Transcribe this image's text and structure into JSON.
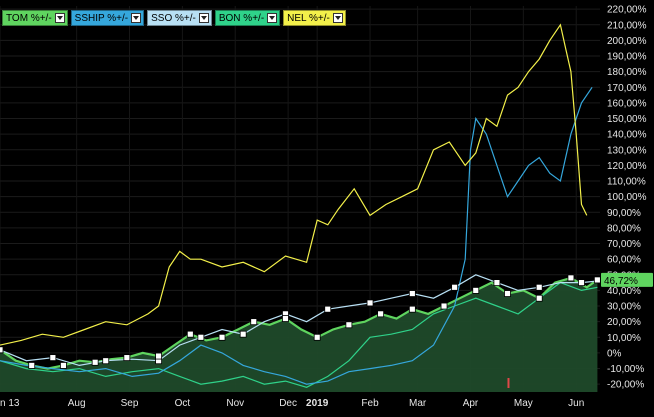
{
  "legend": [
    {
      "label": "TOM %+/-",
      "color": "#5fd45f"
    },
    {
      "label": "SSHIP %+/-",
      "color": "#35a7dc"
    },
    {
      "label": "SSO %+/-",
      "color": "#b8e0f4"
    },
    {
      "label": "BON %+/-",
      "color": "#2fd28a"
    },
    {
      "label": "NEL %+/-",
      "color": "#f3f04a"
    }
  ],
  "last_value_label": "46,72%",
  "chart_data": {
    "type": "line",
    "ylim": [
      -25,
      222
    ],
    "y_ticks": [
      "220,00%",
      "210,00%",
      "200,00%",
      "190,00%",
      "180,00%",
      "170,00%",
      "160,00%",
      "150,00%",
      "140,00%",
      "130,00%",
      "120,00%",
      "110,00%",
      "100,00%",
      "90,00%",
      "80,00%",
      "70,00%",
      "60,00%",
      "50,00%",
      "40,00%",
      "30,00%",
      "20,00%",
      "10,00%",
      "0%",
      "-10,00%",
      "-20,00%"
    ],
    "y_tick_values": [
      220,
      210,
      200,
      190,
      180,
      170,
      160,
      150,
      140,
      130,
      120,
      110,
      100,
      90,
      80,
      70,
      60,
      50,
      40,
      30,
      20,
      10,
      0,
      -10,
      -20
    ],
    "x_tick_labels": [
      "n 13",
      "Aug",
      "Sep",
      "Oct",
      "Nov",
      "Dec",
      "2019",
      "Feb",
      "Mar",
      "Apr",
      "May",
      "Jun"
    ],
    "x_tick_pos": [
      0,
      1.45,
      2.45,
      3.45,
      4.45,
      5.45,
      6.0,
      7.0,
      7.9,
      8.9,
      9.9,
      10.9
    ],
    "x_range": [
      0,
      11.35
    ],
    "series": [
      {
        "name": "NEL %+/-",
        "color": "#f3f04a",
        "x": [
          0,
          0.4,
          0.8,
          1.2,
          1.6,
          2.0,
          2.4,
          2.8,
          3.0,
          3.2,
          3.4,
          3.6,
          3.8,
          4.2,
          4.6,
          5.0,
          5.4,
          5.8,
          6.0,
          6.2,
          6.4,
          6.7,
          7.0,
          7.3,
          7.6,
          7.9,
          8.2,
          8.5,
          8.8,
          9.0,
          9.2,
          9.4,
          9.6,
          9.8,
          10.0,
          10.2,
          10.4,
          10.6,
          10.7,
          10.8,
          10.9,
          11.0,
          11.1
        ],
        "values": [
          5,
          8,
          12,
          10,
          15,
          20,
          18,
          25,
          30,
          55,
          65,
          60,
          60,
          55,
          58,
          52,
          62,
          58,
          85,
          82,
          92,
          105,
          88,
          95,
          100,
          105,
          130,
          135,
          120,
          128,
          150,
          145,
          165,
          170,
          180,
          188,
          200,
          210,
          195,
          180,
          140,
          95,
          88
        ]
      },
      {
        "name": "SSHIP %+/-",
        "color": "#35a7dc",
        "x": [
          0,
          0.5,
          1.0,
          1.5,
          2.0,
          2.5,
          3.0,
          3.4,
          3.8,
          4.2,
          4.6,
          5.0,
          5.4,
          5.8,
          6.2,
          6.6,
          7.0,
          7.4,
          7.8,
          8.2,
          8.6,
          8.8,
          8.9,
          9.0,
          9.2,
          9.4,
          9.6,
          9.8,
          10.0,
          10.2,
          10.4,
          10.6,
          10.8,
          11.0,
          11.2
        ],
        "values": [
          -5,
          -8,
          -10,
          -12,
          -10,
          -15,
          -13,
          -5,
          5,
          0,
          -8,
          -12,
          -15,
          -20,
          -18,
          -12,
          -10,
          -8,
          -5,
          5,
          30,
          60,
          130,
          150,
          140,
          120,
          100,
          110,
          120,
          125,
          115,
          110,
          140,
          160,
          170
        ]
      },
      {
        "name": "SSO %+/-",
        "color": "#b8e0f4",
        "x": [
          0,
          0.5,
          1.0,
          1.5,
          2.0,
          2.5,
          3.0,
          3.4,
          3.8,
          4.2,
          4.6,
          5.0,
          5.4,
          5.8,
          6.2,
          6.6,
          7.0,
          7.4,
          7.8,
          8.2,
          8.6,
          9.0,
          9.4,
          9.8,
          10.2,
          10.6,
          11.0,
          11.3
        ],
        "values": [
          2,
          -5,
          -3,
          -8,
          -5,
          -4,
          -5,
          5,
          10,
          15,
          12,
          20,
          25,
          20,
          28,
          30,
          32,
          35,
          38,
          35,
          42,
          50,
          45,
          40,
          42,
          45,
          45,
          46
        ]
      },
      {
        "name": "BON %+/-",
        "color": "#2fd28a",
        "x": [
          0,
          0.5,
          1.0,
          1.5,
          2.0,
          2.5,
          3.0,
          3.4,
          3.8,
          4.2,
          4.6,
          5.0,
          5.4,
          5.8,
          6.2,
          6.6,
          7.0,
          7.4,
          7.8,
          8.2,
          8.6,
          9.0,
          9.4,
          9.8,
          10.2,
          10.6,
          11.0,
          11.3
        ],
        "values": [
          -5,
          -10,
          -12,
          -10,
          -15,
          -12,
          -10,
          -15,
          -20,
          -18,
          -15,
          -20,
          -18,
          -22,
          -15,
          -5,
          10,
          12,
          15,
          25,
          30,
          35,
          30,
          25,
          35,
          45,
          40,
          42
        ]
      },
      {
        "name": "TOM %+/-",
        "color": "#5fd45f",
        "fill": "#1f4a2a",
        "x": [
          0,
          0.3,
          0.6,
          0.9,
          1.2,
          1.5,
          1.8,
          2.1,
          2.4,
          2.7,
          3.0,
          3.3,
          3.6,
          3.9,
          4.2,
          4.5,
          4.8,
          5.1,
          5.4,
          5.7,
          6.0,
          6.3,
          6.6,
          6.9,
          7.2,
          7.5,
          7.8,
          8.1,
          8.4,
          8.7,
          9.0,
          9.3,
          9.6,
          9.9,
          10.2,
          10.5,
          10.8,
          11.1,
          11.3
        ],
        "values": [
          2,
          -5,
          -8,
          -10,
          -8,
          -5,
          -6,
          -4,
          -3,
          0,
          -2,
          5,
          12,
          8,
          10,
          15,
          20,
          18,
          22,
          15,
          10,
          15,
          18,
          20,
          25,
          22,
          28,
          25,
          30,
          35,
          40,
          45,
          38,
          40,
          35,
          45,
          48,
          42,
          46.72
        ]
      }
    ],
    "markers_on_series": [
      "SSO %+/-",
      "TOM %+/-"
    ]
  }
}
